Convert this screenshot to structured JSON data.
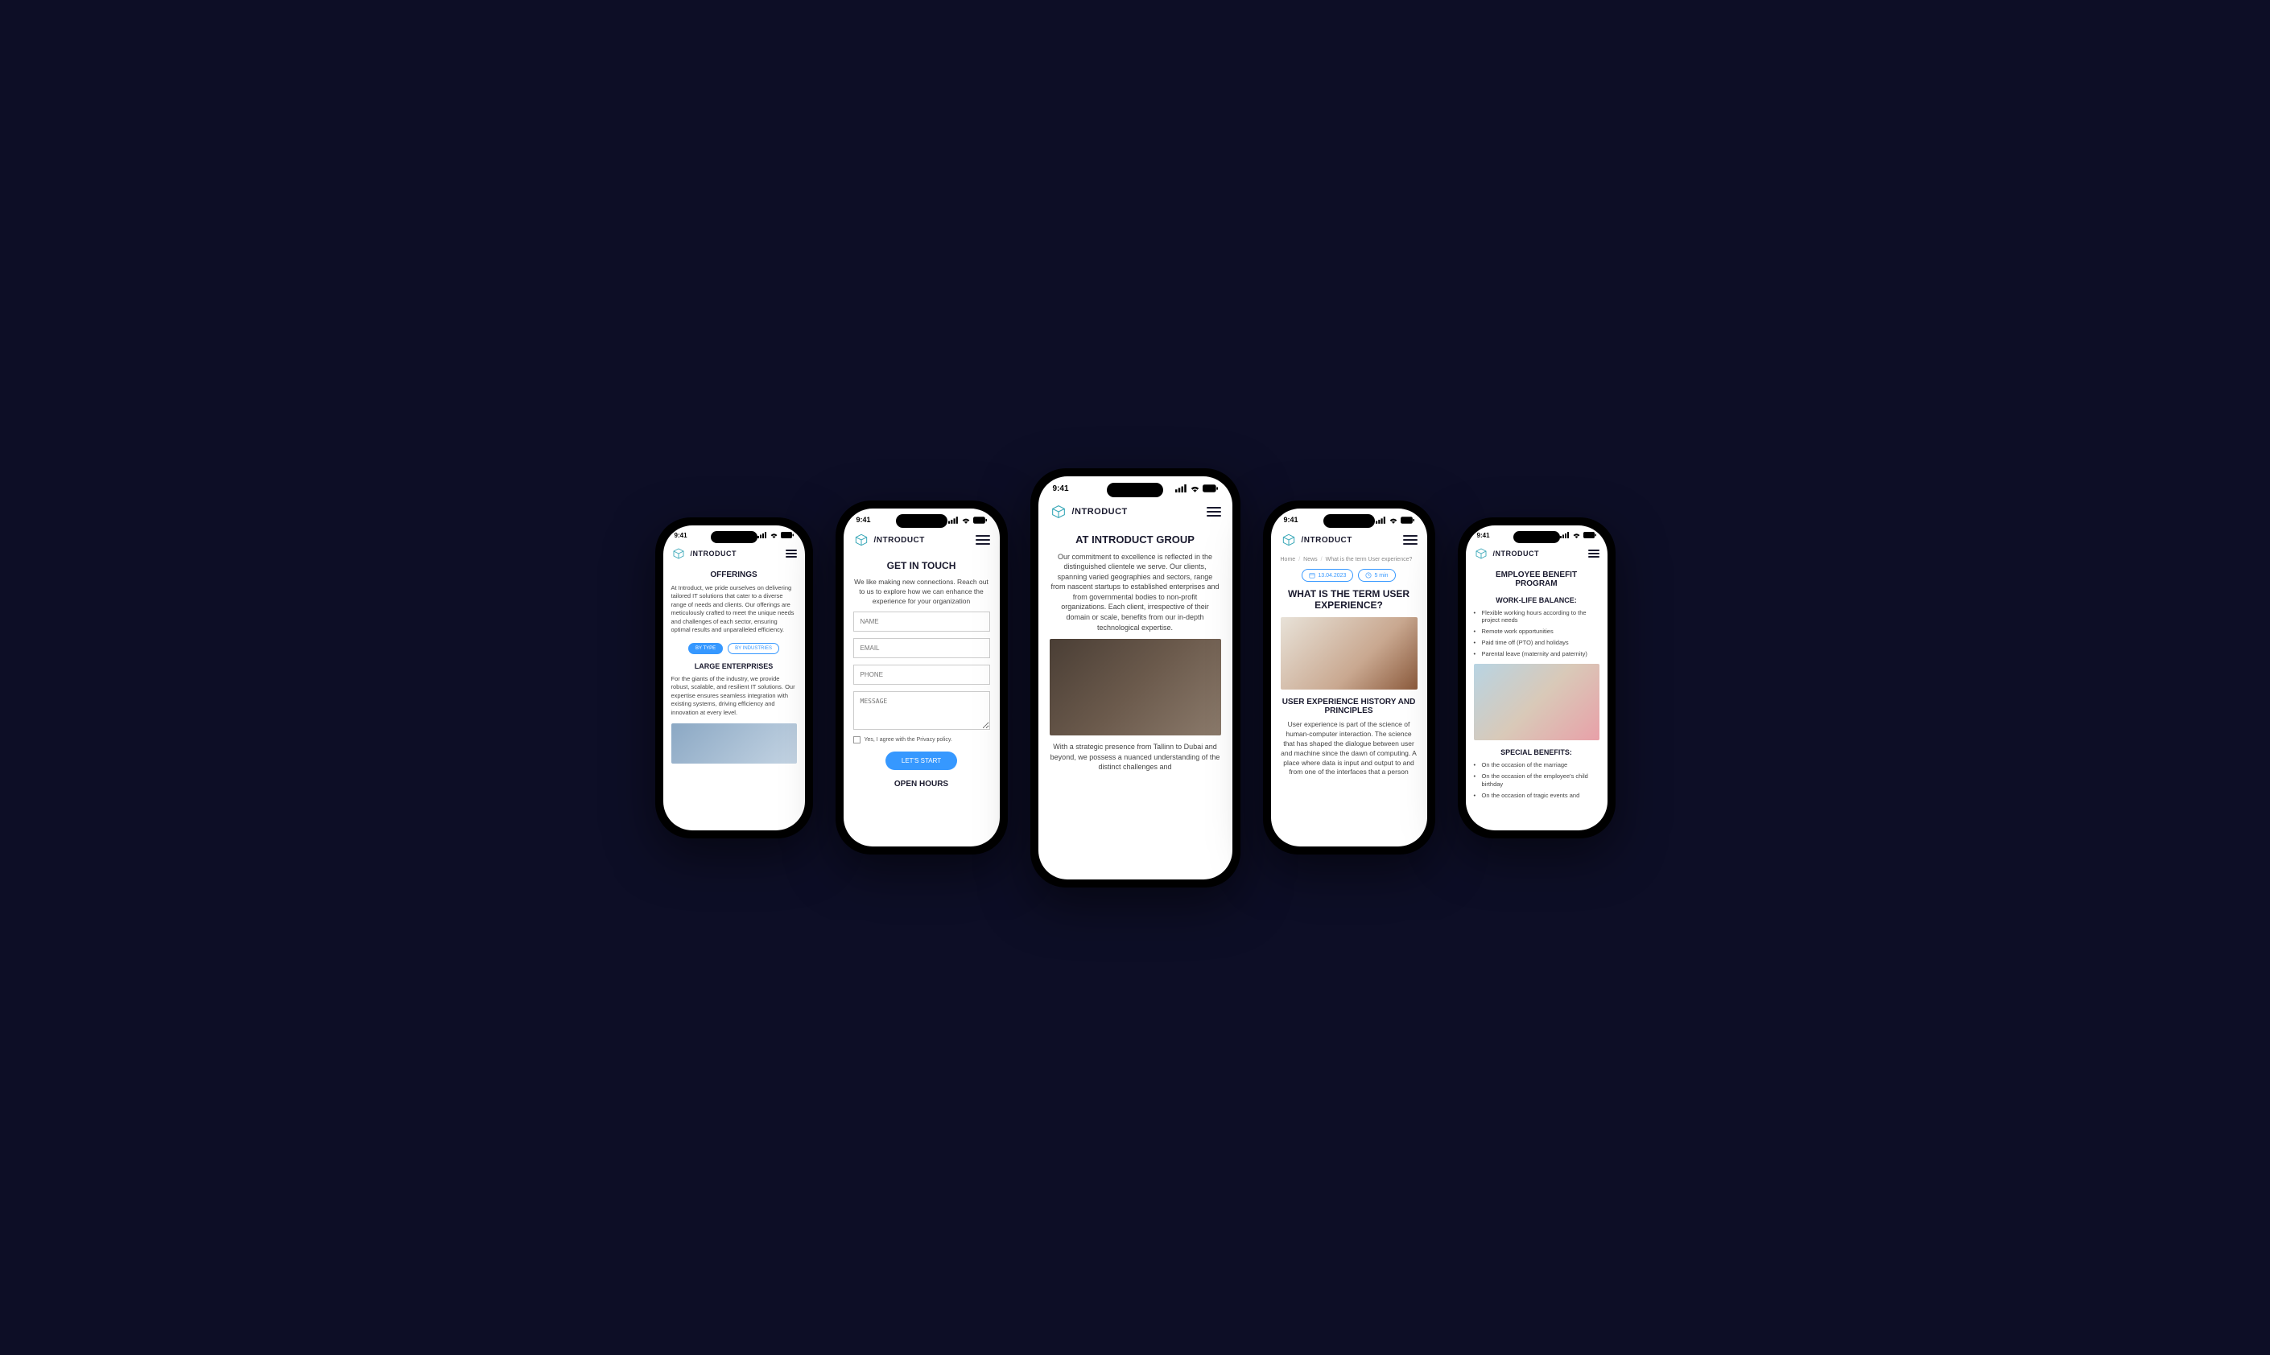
{
  "status": {
    "time": "9:41"
  },
  "brand": "/NTRODUCT",
  "screens": {
    "offerings": {
      "title": "OFFERINGS",
      "intro": "At Introduct, we pride ourselves on delivering tailored IT solutions that cater to a diverse range of needs and clients. Our offerings are meticulously crafted to meet the unique needs and challenges of each sector, ensuring optimal results and unparalleled efficiency.",
      "tabs": {
        "by_type": "BY TYPE",
        "by_industries": "BY INDUSTRIES"
      },
      "section_title": "LARGE ENTERPRISES",
      "section_body": "For the giants of the industry, we provide robust, scalable, and resilient IT solutions. Our expertise ensures seamless integration with existing systems, driving efficiency and innovation at every level."
    },
    "contact": {
      "title": "GET IN TOUCH",
      "intro": "We like making new connections. Reach out to us to explore how we can enhance the experience for your organization",
      "fields": {
        "name": "NAME",
        "email": "EMAIL",
        "phone": "PHONE",
        "message": "MESSAGE"
      },
      "checkbox": "Yes, I agree with the Privacy policy.",
      "button": "LET'S START",
      "footer": "OPEN HOURS"
    },
    "about": {
      "title": "AT INTRODUCT GROUP",
      "p1": "Our commitment to excellence is reflected in the distinguished clientele we serve. Our clients, spanning varied geographies and sectors, range from nascent startups to established enterprises and from governmental bodies to non-profit organizations. Each client, irrespective of their domain or scale, benefits from our in-depth technological expertise.",
      "p2": "With a strategic presence from Tallinn to Dubai and beyond, we possess a nuanced understanding of the distinct challenges and"
    },
    "article": {
      "breadcrumb": {
        "home": "Home",
        "news": "News",
        "current": "What is the term User experience?"
      },
      "date": "13.04.2023",
      "read_time": "5 min",
      "title": "WHAT IS THE TERM USER EXPERIENCE?",
      "subtitle": "USER EXPERIENCE HISTORY AND PRINCIPLES",
      "body": "User experience is part of the science of human-computer interaction. The science that has shaped the dialogue between user and machine since the dawn of computing. A place where data is input and output to and from one of the interfaces that a person"
    },
    "benefits": {
      "title": "EMPLOYEE BENEFIT PROGRAM",
      "section1_title": "WORK-LIFE BALANCE:",
      "section1_items": [
        "Flexible working hours according to the project needs",
        "Remote work opportunities",
        "Paid time off (PTO) and holidays",
        "Parental leave (maternity and paternity)"
      ],
      "section2_title": "SPECIAL BENEFITS:",
      "section2_items": [
        "On the occasion of the marriage",
        "On the occasion of the employee's child birthday",
        "On the occasion of tragic events and"
      ]
    }
  }
}
